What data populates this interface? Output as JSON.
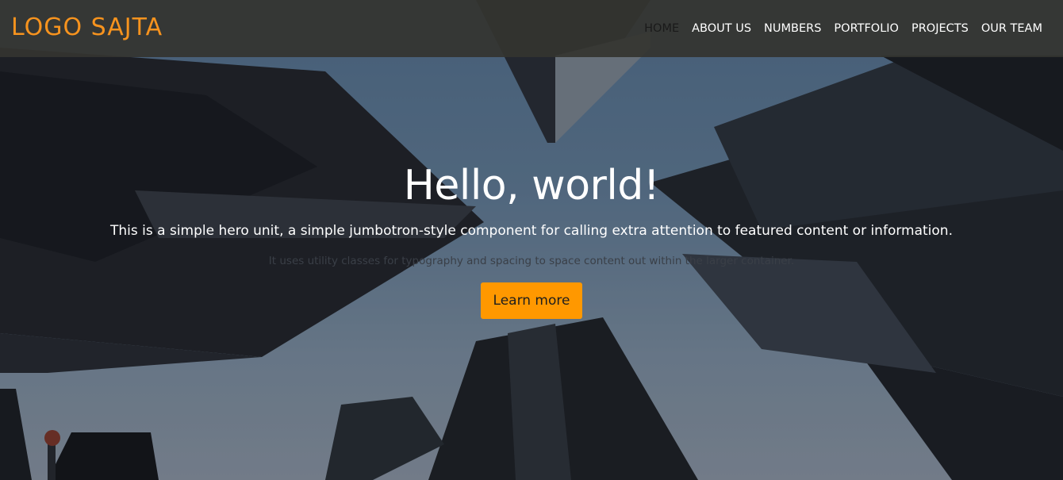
{
  "brand": {
    "logo_text": "LOGO SAJTA"
  },
  "colors": {
    "brand_orange": "#f7931e",
    "button_bg": "#ff9800",
    "navbar_bg": "#343430",
    "nav_active": "#1a1a1a"
  },
  "nav": {
    "items": [
      {
        "label": "HOME",
        "active": true
      },
      {
        "label": "ABOUT US",
        "active": false
      },
      {
        "label": "NUMBERS",
        "active": false
      },
      {
        "label": "PORTFOLIO",
        "active": false
      },
      {
        "label": "PROJECTS",
        "active": false
      },
      {
        "label": "OUR TEAM",
        "active": false
      }
    ]
  },
  "hero": {
    "title": "Hello, world!",
    "lead": "This is a simple hero unit, a simple jumbotron-style component for calling extra attention to featured content or information.",
    "sub": "It uses utility classes for typography and spacing to space content out within the larger container.",
    "button_label": "Learn more"
  }
}
